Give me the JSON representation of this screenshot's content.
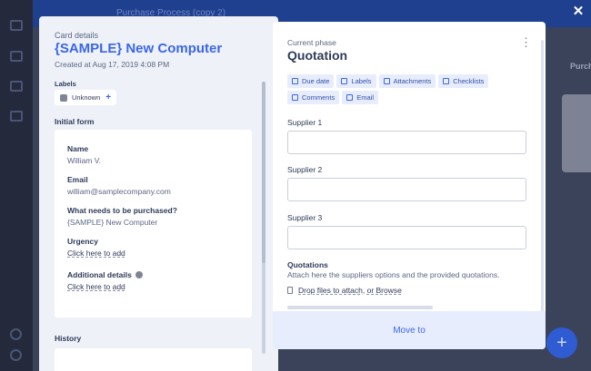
{
  "app": {
    "board_title": "Purchase Process (copy 2)",
    "column_title": "Purch",
    "fab_label": "+"
  },
  "modal": {
    "close_label": "✕"
  },
  "card": {
    "section_label": "Card details",
    "title": "{SAMPLE} New Computer",
    "created": "Created at Aug 17, 2019 4:08 PM",
    "labels_title": "Labels",
    "label_chip": "Unknown",
    "label_add": "+",
    "initial_form_title": "Initial form",
    "history_title": "History",
    "fields": [
      {
        "label": "Name",
        "value": "William V."
      },
      {
        "label": "Email",
        "value": "william@samplecompany.com"
      },
      {
        "label": "What needs to be purchased?",
        "value": "{SAMPLE} New Computer"
      },
      {
        "label": "Urgency",
        "value": "Click here to add"
      },
      {
        "label": "Additional details",
        "value": "Click here to add"
      }
    ]
  },
  "phase": {
    "label": "Current phase",
    "title": "Quotation",
    "menu": "⋮",
    "chips": [
      {
        "label": "Due date",
        "icon": "calendar-icon"
      },
      {
        "label": "Labels",
        "icon": "tag-icon"
      },
      {
        "label": "Attachments",
        "icon": "paperclip-icon"
      },
      {
        "label": "Checklists",
        "icon": "checklist-icon"
      },
      {
        "label": "Comments",
        "icon": "comment-icon"
      },
      {
        "label": "Email",
        "icon": "mail-icon"
      }
    ],
    "fields": [
      {
        "label": "Supplier 1",
        "value": ""
      },
      {
        "label": "Supplier 2",
        "value": ""
      },
      {
        "label": "Supplier 3",
        "value": ""
      }
    ],
    "quotations_title": "Quotations",
    "quotations_desc": "Attach here the suppliers options and the provided quotations.",
    "drop_link": "Drop files to attach, or Browse",
    "move_to": "Move to"
  },
  "colors": {
    "accent": "#3a66e8",
    "panel_bg": "#eef2f8",
    "chip_bg": "#e8edfd"
  }
}
